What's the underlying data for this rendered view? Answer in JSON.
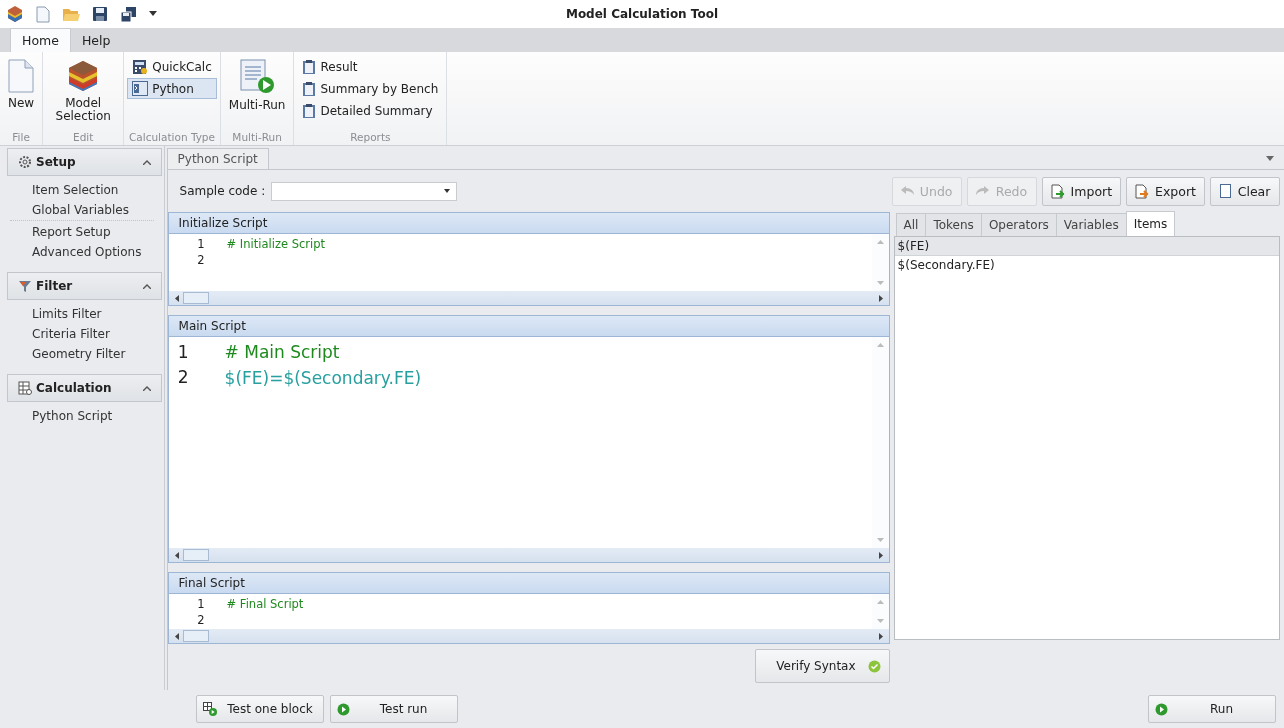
{
  "window": {
    "title": "Model Calculation Tool"
  },
  "ribbon": {
    "tabs": [
      {
        "label": "Home",
        "selected": true
      },
      {
        "label": "Help",
        "selected": false
      }
    ],
    "groups": [
      {
        "label": "File",
        "items": [
          {
            "label": "New",
            "kind": "large",
            "selected": false
          }
        ]
      },
      {
        "label": "Edit",
        "items": [
          {
            "label": "Model Selection",
            "kind": "large",
            "selected": false
          }
        ]
      },
      {
        "label": "Calculation Type",
        "items": [
          {
            "label": "QuickCalc",
            "kind": "small",
            "selected": false
          },
          {
            "label": "Python",
            "kind": "small",
            "selected": true
          }
        ]
      },
      {
        "label": "Multi-Run",
        "items": [
          {
            "label": "Multi-Run",
            "kind": "large",
            "selected": false
          }
        ]
      },
      {
        "label": "Reports",
        "items": [
          {
            "label": "Result",
            "kind": "small",
            "selected": false
          },
          {
            "label": "Summary by Bench",
            "kind": "small",
            "selected": false
          },
          {
            "label": "Detailed Summary",
            "kind": "small",
            "selected": false
          }
        ]
      }
    ]
  },
  "sidebar": {
    "sections": [
      {
        "title": "Setup",
        "expanded": true,
        "groups": [
          [
            "Item Selection",
            "Global Variables"
          ],
          [
            "Report Setup",
            "Advanced Options"
          ]
        ]
      },
      {
        "title": "Filter",
        "expanded": true,
        "groups": [
          [
            "Limits Filter",
            "Criteria Filter",
            "Geometry Filter"
          ]
        ]
      },
      {
        "title": "Calculation",
        "expanded": true,
        "groups": [
          [
            "Python Script"
          ]
        ]
      }
    ]
  },
  "document_tabs": [
    {
      "label": "Python Script",
      "selected": true
    }
  ],
  "sample_code": {
    "label": "Sample code :"
  },
  "toolbar": [
    {
      "label": "Undo",
      "disabled": true
    },
    {
      "label": "Redo",
      "disabled": true
    },
    {
      "label": "Import",
      "disabled": false
    },
    {
      "label": "Export",
      "disabled": false
    },
    {
      "label": "Clear",
      "disabled": false
    }
  ],
  "editors": [
    {
      "title": "Initialize Script",
      "kind": "small",
      "lines": [
        {
          "number": "1",
          "text": "# Initialize Script",
          "kind": "comment"
        },
        {
          "number": "2"
        }
      ]
    },
    {
      "title": "Main Script",
      "kind": "large",
      "lines": [
        {
          "number": "1",
          "text": "# Main Script",
          "kind": "comment"
        },
        {
          "number": "2",
          "text": "$(FE)=$(Secondary.FE)",
          "kind": "code"
        }
      ]
    },
    {
      "title": "Final Script",
      "kind": "small",
      "lines": [
        {
          "number": "1",
          "text": "# Final Script",
          "kind": "comment"
        },
        {
          "number": "2"
        }
      ]
    }
  ],
  "palette": {
    "tabs": [
      {
        "label": "All",
        "selected": false
      },
      {
        "label": "Tokens",
        "selected": false
      },
      {
        "label": "Operators",
        "selected": false
      },
      {
        "label": "Variables",
        "selected": false
      },
      {
        "label": "Items",
        "selected": true
      }
    ],
    "items": [
      {
        "text": "$(FE)",
        "selected": true
      },
      {
        "text": "$(Secondary.FE)",
        "selected": false
      }
    ]
  },
  "verify_button": {
    "label": "Verify Syntax"
  },
  "bottom_buttons": [
    {
      "label": "Test one block"
    },
    {
      "label": "Test run"
    }
  ],
  "run_button": {
    "label": "Run"
  }
}
